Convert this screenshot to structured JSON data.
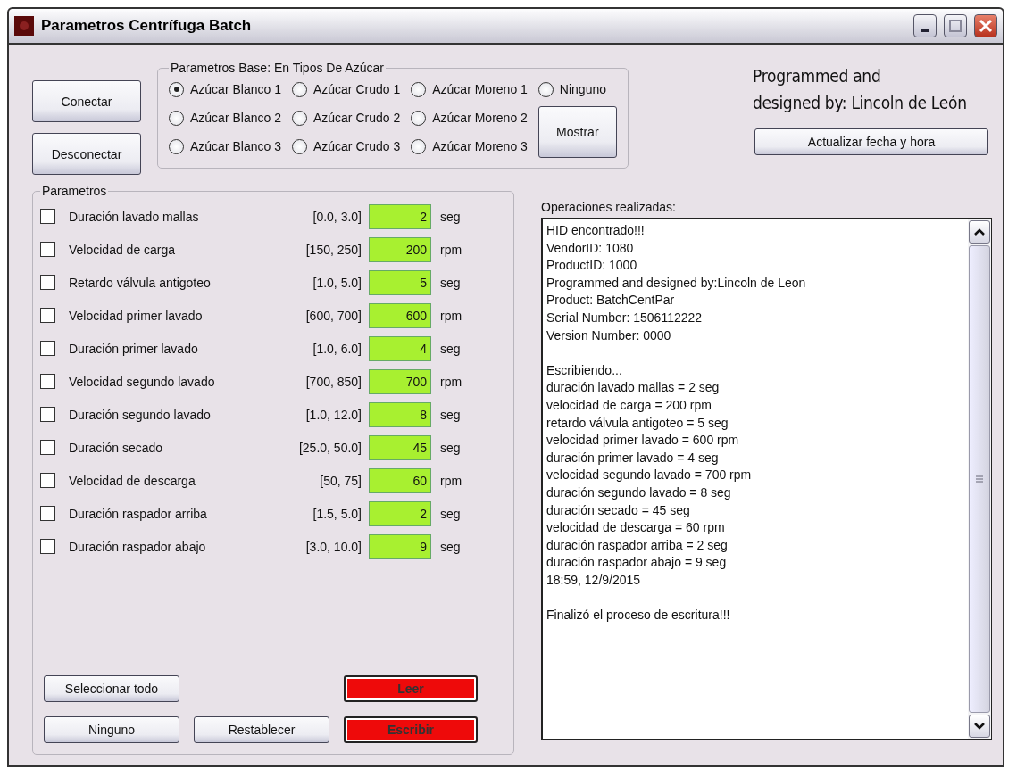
{
  "window": {
    "title": "Parametros Centrífuga Batch"
  },
  "connection_buttons": [
    "Conectar",
    "Desconectar"
  ],
  "sugar_group": {
    "title": "Parametros Base: En Tipos De Azúcar",
    "radio_rows": [
      [
        {
          "label": "Azúcar Blanco 1",
          "selected": true
        },
        {
          "label": "Azúcar Crudo 1",
          "selected": false
        },
        {
          "label": "Azúcar Moreno 1",
          "selected": false
        },
        {
          "label": "Ninguno",
          "selected": false
        }
      ],
      [
        {
          "label": "Azúcar Blanco 2",
          "selected": false
        },
        {
          "label": "Azúcar Crudo 2",
          "selected": false
        },
        {
          "label": "Azúcar Moreno 2",
          "selected": false
        }
      ],
      [
        {
          "label": "Azúcar Blanco 3",
          "selected": false
        },
        {
          "label": "Azúcar Crudo 3",
          "selected": false
        },
        {
          "label": "Azúcar Moreno 3",
          "selected": false
        }
      ]
    ],
    "show_button": "Mostrar"
  },
  "credits": [
    "Programmed and",
    "designed by: Lincoln de León"
  ],
  "update_button": "Actualizar fecha y hora",
  "parameters": {
    "title": "Parametros",
    "rows": [
      {
        "name": "Duración lavado mallas",
        "checked": false,
        "range": "[0.0, 3.0]",
        "value": "2",
        "unit": "seg"
      },
      {
        "name": "Velocidad de carga",
        "checked": false,
        "range": "[150, 250]",
        "value": "200",
        "unit": "rpm"
      },
      {
        "name": "Retardo válvula antigoteo",
        "checked": false,
        "range": "[1.0, 5.0]",
        "value": "5",
        "unit": "seg"
      },
      {
        "name": "Velocidad primer lavado",
        "checked": false,
        "range": "[600, 700]",
        "value": "600",
        "unit": "rpm"
      },
      {
        "name": "Duración primer lavado",
        "checked": false,
        "range": "[1.0, 6.0]",
        "value": "4",
        "unit": "seg"
      },
      {
        "name": "Velocidad segundo lavado",
        "checked": false,
        "range": "[700, 850]",
        "value": "700",
        "unit": "rpm"
      },
      {
        "name": "Duración segundo lavado",
        "checked": false,
        "range": "[1.0, 12.0]",
        "value": "8",
        "unit": "seg"
      },
      {
        "name": "Duración secado",
        "checked": false,
        "range": "[25.0, 50.0]",
        "value": "45",
        "unit": "seg"
      },
      {
        "name": "Velocidad de descarga",
        "checked": false,
        "range": "[50, 75]",
        "value": "60",
        "unit": "rpm"
      },
      {
        "name": "Duración raspador arriba",
        "checked": false,
        "range": "[1.5, 5.0]",
        "value": "2",
        "unit": "seg"
      },
      {
        "name": "Duración raspador abajo",
        "checked": false,
        "range": "[3.0, 10.0]",
        "value": "9",
        "unit": "seg"
      }
    ],
    "buttons": [
      {
        "label": "Seleccionar todo",
        "kind": "normal"
      },
      {
        "label": "Leer",
        "kind": "danger"
      },
      {
        "label": "Ninguno",
        "kind": "normal"
      },
      {
        "label": "Restablecer",
        "kind": "normal"
      },
      {
        "label": "Escribir",
        "kind": "danger"
      }
    ]
  },
  "log": {
    "label": "Operaciones realizadas:",
    "paragraphs": [
      [
        "HID encontrado!!!",
        "VendorID: 1080",
        "ProductID: 1000",
        "Programmed and designed by:Lincoln de Leon",
        "Product: BatchCentPar",
        "Serial Number: 1506112222",
        "Version Number: 0000"
      ],
      [
        "Escribiendo...",
        "duración lavado mallas = 2 seg",
        "velocidad de carga = 200 rpm",
        "retardo válvula antigoteo = 5 seg",
        "velocidad primer lavado = 600 rpm",
        "duración primer lavado = 4 seg",
        "velocidad segundo lavado = 700 rpm",
        "duración segundo lavado = 8 seg",
        "duración secado = 45 seg",
        "velocidad de descarga = 60 rpm",
        "duración raspador arriba = 2 seg",
        "duración raspador abajo = 9 seg",
        "18:59, 12/9/2015"
      ],
      [
        "Finalizó el proceso de escritura!!!"
      ]
    ]
  }
}
